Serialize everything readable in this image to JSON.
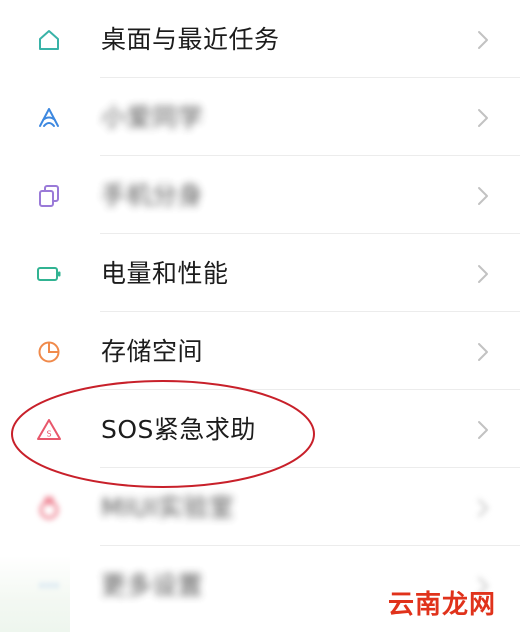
{
  "settings": {
    "items": [
      {
        "label": "桌面与最近任务",
        "icon": "home-icon",
        "blurred": false
      },
      {
        "label": "小爱同学",
        "icon": "xiaoai-icon",
        "blurred": true
      },
      {
        "label": "手机分身",
        "icon": "dual-copy-icon",
        "blurred": true
      },
      {
        "label": "电量和性能",
        "icon": "battery-icon",
        "blurred": false
      },
      {
        "label": "存储空间",
        "icon": "storage-pie-icon",
        "blurred": false
      },
      {
        "label": "SOS紧急求助",
        "icon": "sos-warning-icon",
        "blurred": false
      },
      {
        "label": "MIUI实验室",
        "icon": "lab-flask-icon",
        "blurred": true
      },
      {
        "label": "更多设置",
        "icon": "more-dots-icon",
        "blurred": true
      }
    ]
  },
  "watermark": {
    "text": "云南龙网"
  },
  "colors": {
    "icon_teal": "#39b3a8",
    "icon_blue": "#3d88e0",
    "icon_purple": "#9a7ad8",
    "icon_green": "#31b392",
    "icon_orange": "#f08a4b",
    "icon_red": "#e8576b",
    "chevron": "#c2c2c2",
    "annotation_circle": "#c8202a",
    "watermark": "#e0321b"
  }
}
